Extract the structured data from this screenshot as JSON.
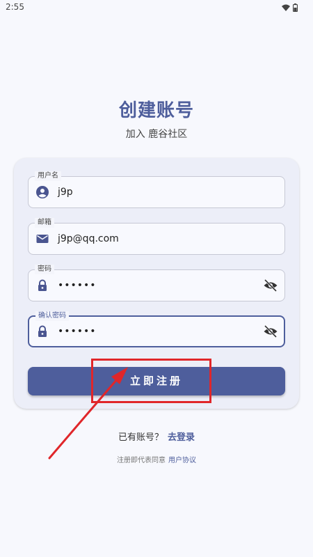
{
  "status_bar": {
    "time": "2:55",
    "wifi_icon": "wifi-icon",
    "battery_icon": "battery-icon"
  },
  "header": {
    "title": "创建账号",
    "subtitle": "加入 鹿谷社区"
  },
  "form": {
    "username": {
      "label": "用户名",
      "value": "j9p",
      "icon": "person-icon"
    },
    "email": {
      "label": "邮箱",
      "value": "j9p@qq.com",
      "icon": "mail-icon"
    },
    "password": {
      "label": "密码",
      "value": "••••••",
      "icon": "lock-icon",
      "toggle_icon": "eye-off-icon"
    },
    "confirm_password": {
      "label": "确认密码",
      "value": "••••••",
      "icon": "lock-icon",
      "toggle_icon": "eye-off-icon"
    }
  },
  "actions": {
    "register_label": "立即注册"
  },
  "footer": {
    "login_prompt": "已有账号？",
    "login_link": "去登录",
    "agreement_text": "注册即代表同意",
    "agreement_link": "用户协议"
  },
  "colors": {
    "accent": "#4e5e9c",
    "annotation": "#e0262a",
    "background": "#f7f8fd",
    "card": "#eceef8"
  }
}
